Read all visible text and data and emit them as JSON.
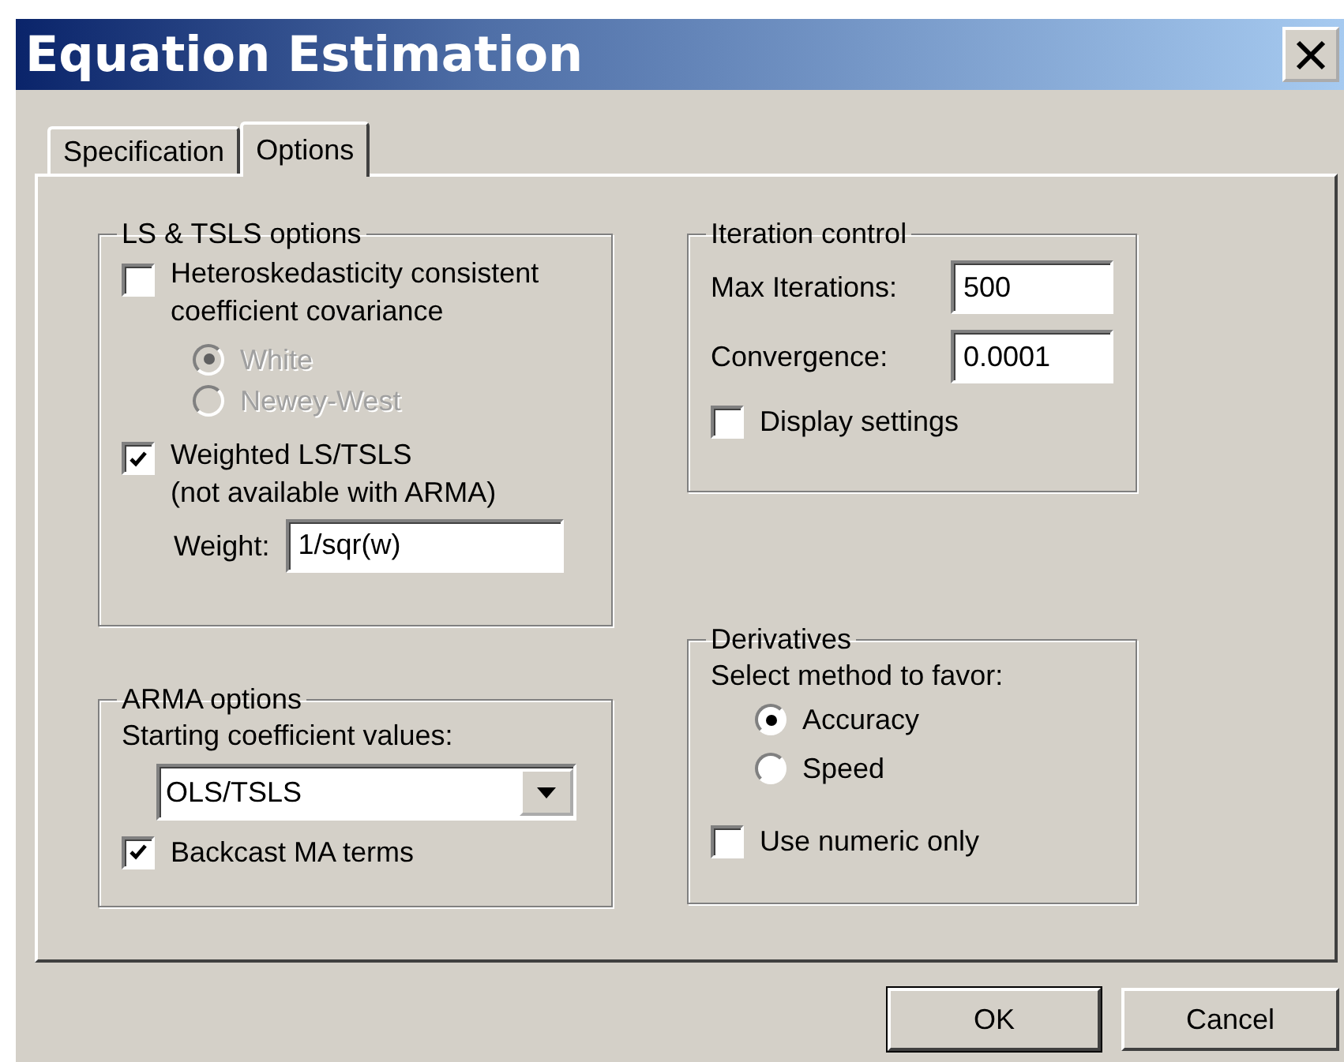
{
  "window": {
    "title": "Equation Estimation"
  },
  "tabs": [
    {
      "label": "Specification",
      "selected": false
    },
    {
      "label": "Options",
      "selected": true
    }
  ],
  "ls_tsls_options": {
    "title": "LS & TSLS options",
    "heteroskedasticity": {
      "label": "Heteroskedasticity consistent coefficient covariance",
      "checked": false
    },
    "covariance_methods": [
      {
        "label": "White",
        "selected": true,
        "disabled": true
      },
      {
        "label": "Newey-West",
        "selected": false,
        "disabled": true
      }
    ],
    "weighted": {
      "label": "Weighted LS/TSLS",
      "note": "(not available with ARMA)",
      "checked": true
    },
    "weight": {
      "label": "Weight:",
      "value": "1/sqr(w)"
    }
  },
  "arma_options": {
    "title": "ARMA options",
    "starting_label": "Starting coefficient values:",
    "starting_value": "OLS/TSLS",
    "backcast": {
      "label": "Backcast MA terms",
      "checked": true
    }
  },
  "iteration_control": {
    "title": "Iteration control",
    "fields": [
      {
        "label": "Max Iterations:",
        "value": "500"
      },
      {
        "label": "Convergence:",
        "value": "0.0001"
      }
    ],
    "display_settings": {
      "label": "Display settings",
      "checked": false
    }
  },
  "derivatives": {
    "title": "Derivatives",
    "prompt": "Select method to favor:",
    "methods": [
      {
        "label": "Accuracy",
        "selected": true,
        "disabled": false
      },
      {
        "label": "Speed",
        "selected": false,
        "disabled": false
      }
    ],
    "numeric_only": {
      "label": "Use numeric only",
      "checked": false
    }
  },
  "buttons": [
    {
      "label": "OK",
      "default": true
    },
    {
      "label": "Cancel",
      "default": false
    }
  ]
}
